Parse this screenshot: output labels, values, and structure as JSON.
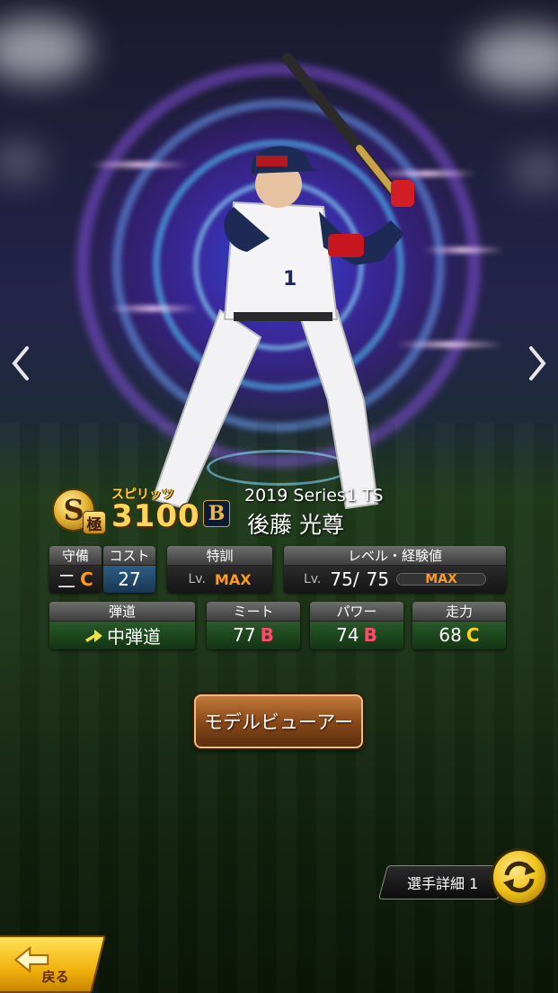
{
  "player": {
    "rank_letter": "S",
    "rank_sub": "極",
    "spirit_label": "スピリッツ",
    "spirit_value": "3100",
    "team_logo_letter": "B",
    "card_series": "2019 Series1 TS",
    "name": "後藤 光尊"
  },
  "stats": {
    "fielding": {
      "label": "守備",
      "position": "二",
      "grade": "C"
    },
    "cost": {
      "label": "コスト",
      "value": "27"
    },
    "training": {
      "label": "特訓",
      "lv_prefix": "Lv.",
      "value": "MAX"
    },
    "level": {
      "label": "レベル・経験値",
      "lv_prefix": "Lv.",
      "current": "75",
      "separator": "/",
      "max": "75",
      "exp_label": "MAX"
    },
    "trajectory": {
      "label": "弾道",
      "value": "中弾道"
    },
    "meet": {
      "label": "ミート",
      "value": "77",
      "grade": "B"
    },
    "power": {
      "label": "パワー",
      "value": "74",
      "grade": "B"
    },
    "speed": {
      "label": "走力",
      "value": "68",
      "grade": "C"
    }
  },
  "buttons": {
    "model_viewer": "モデルビューアー",
    "detail_tab": "選手詳細 1",
    "back": "戻る"
  },
  "colors": {
    "grade_B": "#ff4a6a",
    "grade_C": "#ffd21a",
    "max_orange": "#ff9a1a",
    "button_brown": "#8a4a1a",
    "back_yellow": "#f2b20c"
  },
  "icons": {
    "prev": "chevron-left-icon",
    "next": "chevron-right-icon",
    "swap": "swap-cycle-icon",
    "back": "back-arrow-icon",
    "trajectory": "trajectory-arrow-icon"
  }
}
